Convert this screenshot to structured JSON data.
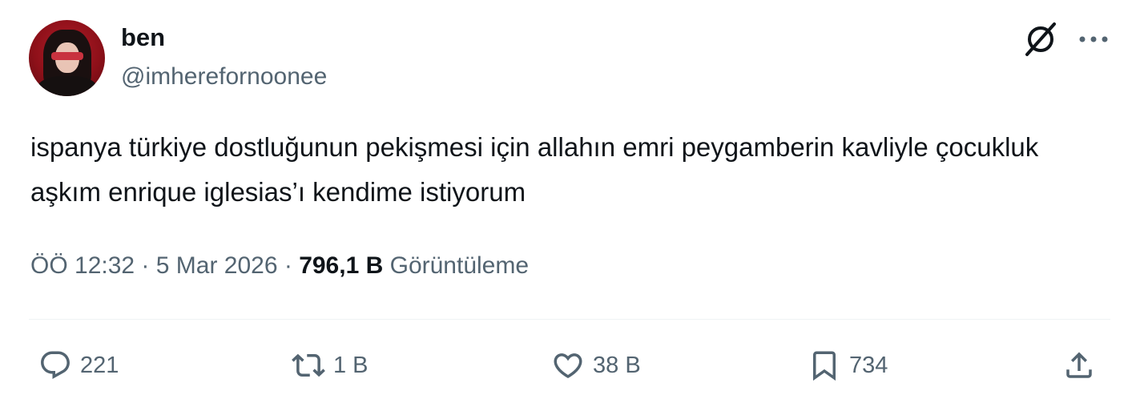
{
  "author": {
    "display_name": "ben",
    "handle": "@imherefornoonee"
  },
  "tweet": {
    "text": "ispanya türkiye dostluğunun pekişmesi için allahın emri peygamberin kavliyle çocukluk aşkım enrique iglesias’ı kendime istiyorum"
  },
  "meta": {
    "time": "ÖÖ 12:32",
    "separator": " · ",
    "date": "5 Mar 2026",
    "views_count": "796,1 B",
    "views_label": "Görüntüleme"
  },
  "actions": {
    "reply_count": "221",
    "retweet_count": "1 B",
    "like_count": "38 B",
    "bookmark_count": "734"
  },
  "icons": {
    "grok": "grok-icon",
    "more": "more-icon",
    "reply": "reply-icon",
    "retweet": "retweet-icon",
    "like": "heart-icon",
    "bookmark": "bookmark-icon",
    "share": "share-icon"
  },
  "colors": {
    "text_primary": "#0f1419",
    "text_secondary": "#536471",
    "divider": "#eff3f4"
  }
}
